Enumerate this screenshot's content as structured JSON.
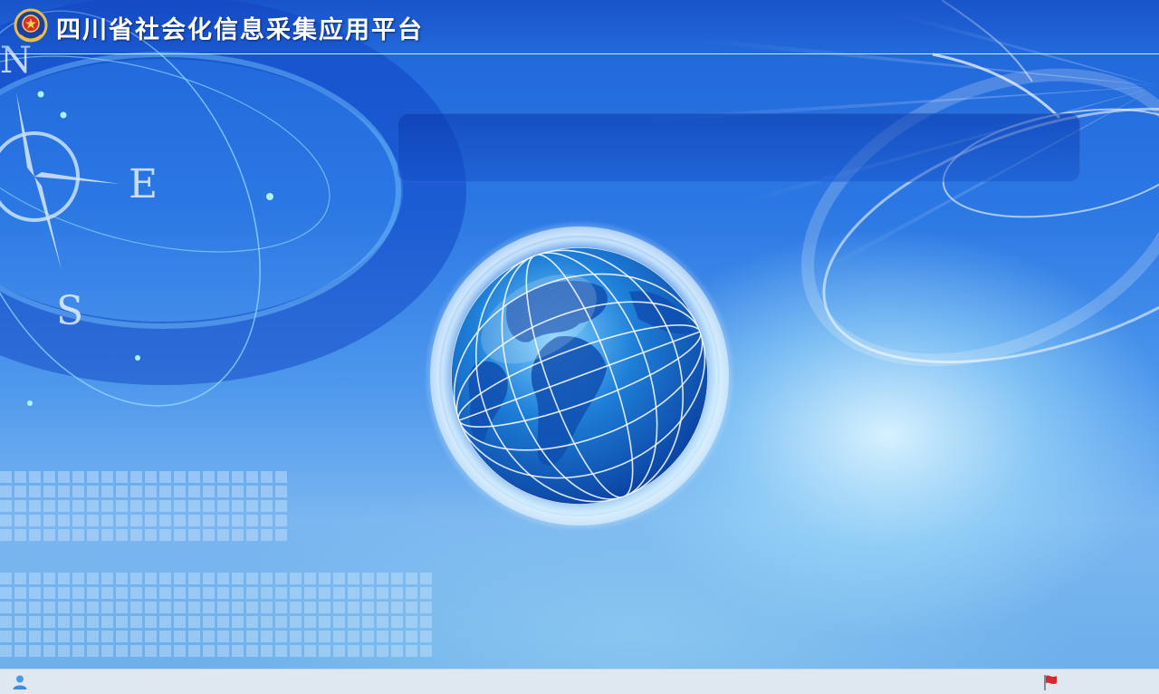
{
  "header": {
    "title": "四川省社会化信息采集应用平台",
    "emblem_icon": "police-emblem-icon"
  },
  "compass": {
    "labels": [
      "N",
      "E",
      "S"
    ]
  },
  "top_panel": {
    "content": ""
  },
  "globe": {
    "icon": "globe-icon"
  },
  "status_bar": {
    "left_icon": "user-icon",
    "right_icon": "flag-icon"
  },
  "colors": {
    "background_top": "#1f64d8",
    "background_bottom": "#6aaeea",
    "status_bar": "#dfe7f1",
    "title_text": "#ffffff"
  }
}
